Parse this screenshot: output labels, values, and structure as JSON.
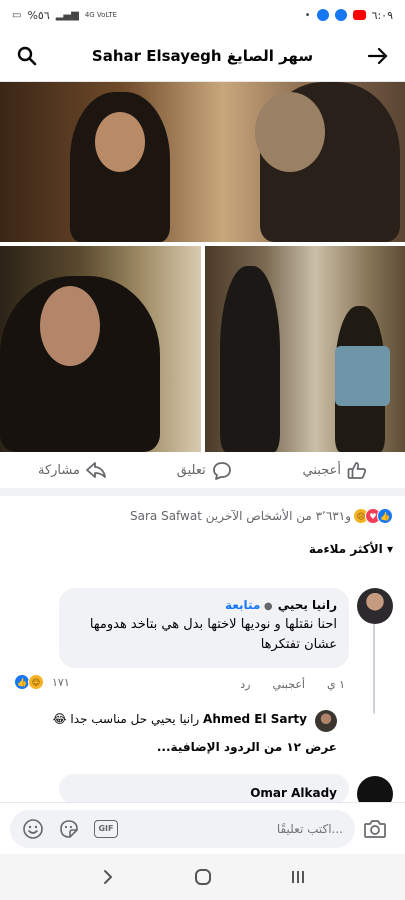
{
  "status_bar": {
    "time": "٦:٠٩",
    "battery": "%٥٦",
    "network": "4G VoLTE"
  },
  "header": {
    "title": "Sahar Elsayegh سهر الصايغ",
    "back_icon": "arrow-right-icon",
    "search_icon": "search-icon"
  },
  "post_actions": {
    "like": "أعجبني",
    "comment": "تعليق",
    "share": "مشاركة"
  },
  "reactions_summary": {
    "text": "Sara Safwat و٣٬٦٣١ من الأشخاص الآخرين",
    "icons": [
      "like",
      "love",
      "sad"
    ]
  },
  "sort": {
    "label": "الأكثر ملاءمة ▾"
  },
  "comments": [
    {
      "name": "رانيا يحيي",
      "follow": "متابعة",
      "text": "احنا نقتلها و نوديها لاختها بدل هي بتاخد هدومها عشان تفتكرها",
      "time": "١ ي",
      "like": "أعجبني",
      "reply": "رد",
      "reaction_count": "١٧١"
    },
    {
      "name": "Ahmed El Sarty",
      "text": "رانيا يحيي حل مناسب جدا 😂"
    }
  ],
  "more_replies": "عرض ١٢ من الردود الإضافية...",
  "next_comment": {
    "name": "Omar Alkady"
  },
  "composer": {
    "placeholder": "اكتب تعليقًا...",
    "gif": "GIF"
  },
  "colors": {
    "accent": "#1877f2",
    "like": "#1877f2",
    "love": "#f33e58",
    "sad": "#f7b125"
  }
}
